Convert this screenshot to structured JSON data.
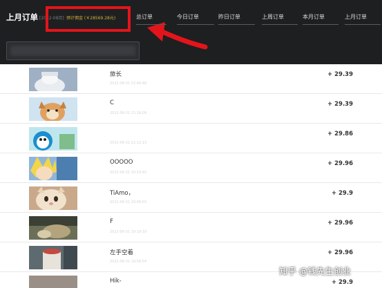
{
  "header": {
    "title": "上月订单",
    "period": "[2022-08月]",
    "earnings": "预计佣金 (￥28569.28元)"
  },
  "tabs": [
    {
      "label": "总订单"
    },
    {
      "label": "今日订单"
    },
    {
      "label": "昨日订单"
    },
    {
      "label": "上周订单"
    },
    {
      "label": "本月订单"
    },
    {
      "label": "上月订单"
    }
  ],
  "orders": [
    {
      "name": "旅长",
      "time": "2022-08-31 22:44:48",
      "amount": "+ 29.39"
    },
    {
      "name": "C",
      "time": "2022-08-31 22:18:09",
      "amount": "+ 29.39"
    },
    {
      "name": "",
      "time": "2022-08-31 22:12:13",
      "amount": "+ 29.86"
    },
    {
      "name": "OOOOO",
      "time": "2022-08-31 20:53:42",
      "amount": "+ 29.96"
    },
    {
      "name": "TiAmo，",
      "time": "2022-08-31 19:49:03",
      "amount": "+ 29.9"
    },
    {
      "name": "F",
      "time": "2022-08-31 19:19:19",
      "amount": "+ 29.96"
    },
    {
      "name": "左手空着",
      "time": "2022-08-31 18:58:54",
      "amount": "+ 29.96"
    },
    {
      "name": "Hik-",
      "time": "",
      "amount": "+ 29.9"
    }
  ],
  "watermark": "知乎 @钱先生创业",
  "colors": {
    "header_bg": "#1e1f21",
    "highlight_red": "#e4141b",
    "earnings_gold": "#d8b23a"
  }
}
